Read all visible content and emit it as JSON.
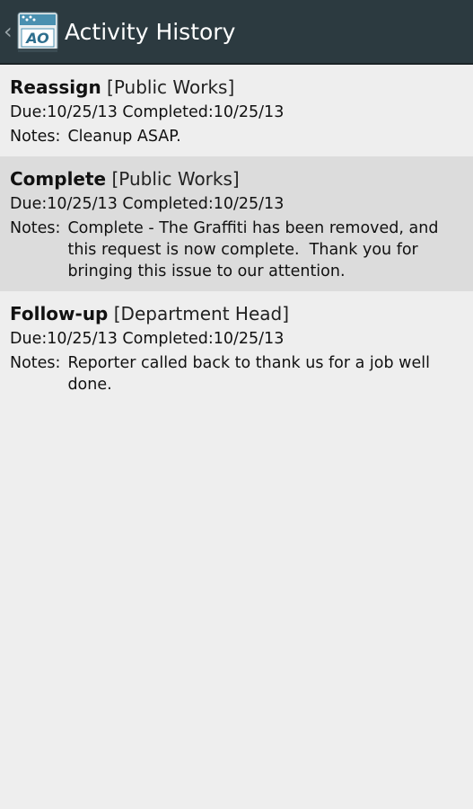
{
  "action_bar": {
    "title": "Activity History",
    "app_icon_text": "AO"
  },
  "activities": [
    {
      "action": "Reassign",
      "department": "[Public Works]",
      "dates": "Due:10/25/13 Completed:10/25/13",
      "notes_label": "Notes:",
      "notes": "Cleanup ASAP.",
      "highlighted": false
    },
    {
      "action": "Complete",
      "department": "[Public Works]",
      "dates": "Due:10/25/13 Completed:10/25/13",
      "notes_label": "Notes:",
      "notes": "Complete - The Graffiti has been removed, and this request is now complete.  Thank you for bringing this issue to our attention.",
      "highlighted": true
    },
    {
      "action": "Follow-up",
      "department": "[Department Head]",
      "dates": "Due:10/25/13 Completed:10/25/13",
      "notes_label": "Notes:",
      "notes": "Reporter called back to thank us for a job well done.",
      "highlighted": false
    }
  ],
  "colors": {
    "action_bar_bg": "#2c3a40",
    "page_bg": "#eeeeee",
    "highlight_bg": "#dcdcdc"
  }
}
